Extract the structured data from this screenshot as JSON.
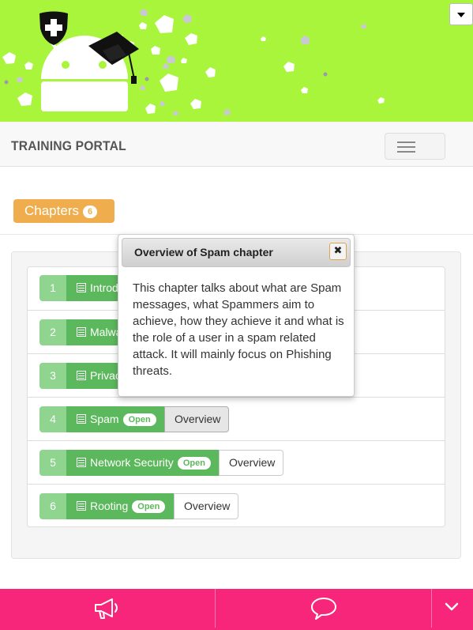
{
  "header": {
    "brand": "TRAINING PORTAL",
    "icons": [
      "android-graduate-logo-icon",
      "shield-cross-icon",
      "dropdown-caret-icon",
      "hamburger-menu-icon"
    ]
  },
  "chapters_button": {
    "label": "Chapters",
    "count": "6"
  },
  "chapters": [
    {
      "number": "1",
      "title": "Introd",
      "badge": "",
      "overview": ""
    },
    {
      "number": "2",
      "title": "Malwa",
      "badge": "",
      "overview": ""
    },
    {
      "number": "3",
      "title": "Privac",
      "badge": "",
      "overview": ""
    },
    {
      "number": "4",
      "title": "Spam",
      "badge": "Open",
      "overview": "Overview"
    },
    {
      "number": "5",
      "title": "Network Security",
      "badge": "Open",
      "overview": "Overview"
    },
    {
      "number": "6",
      "title": "Rooting",
      "badge": "Open",
      "overview": "Overview"
    }
  ],
  "popover": {
    "title": "Overview of Spam chapter",
    "close": "✖",
    "body": "This chapter talks about what are Spam messages, what Spammers aim to achieve, how they achieve it and what is the role of a user in a spam related attack. It will mainly focus on Phishing threats."
  },
  "bottom_bar": {
    "icons": [
      "megaphone-icon",
      "chat-bubble-icon",
      "chevron-down-icon"
    ]
  },
  "colors": {
    "banner": "#a9f53b",
    "warning": "#f0ad4e",
    "success": "#5cb85c",
    "success_light": "#8fd48f",
    "bottom_bar": "#f7267a"
  }
}
